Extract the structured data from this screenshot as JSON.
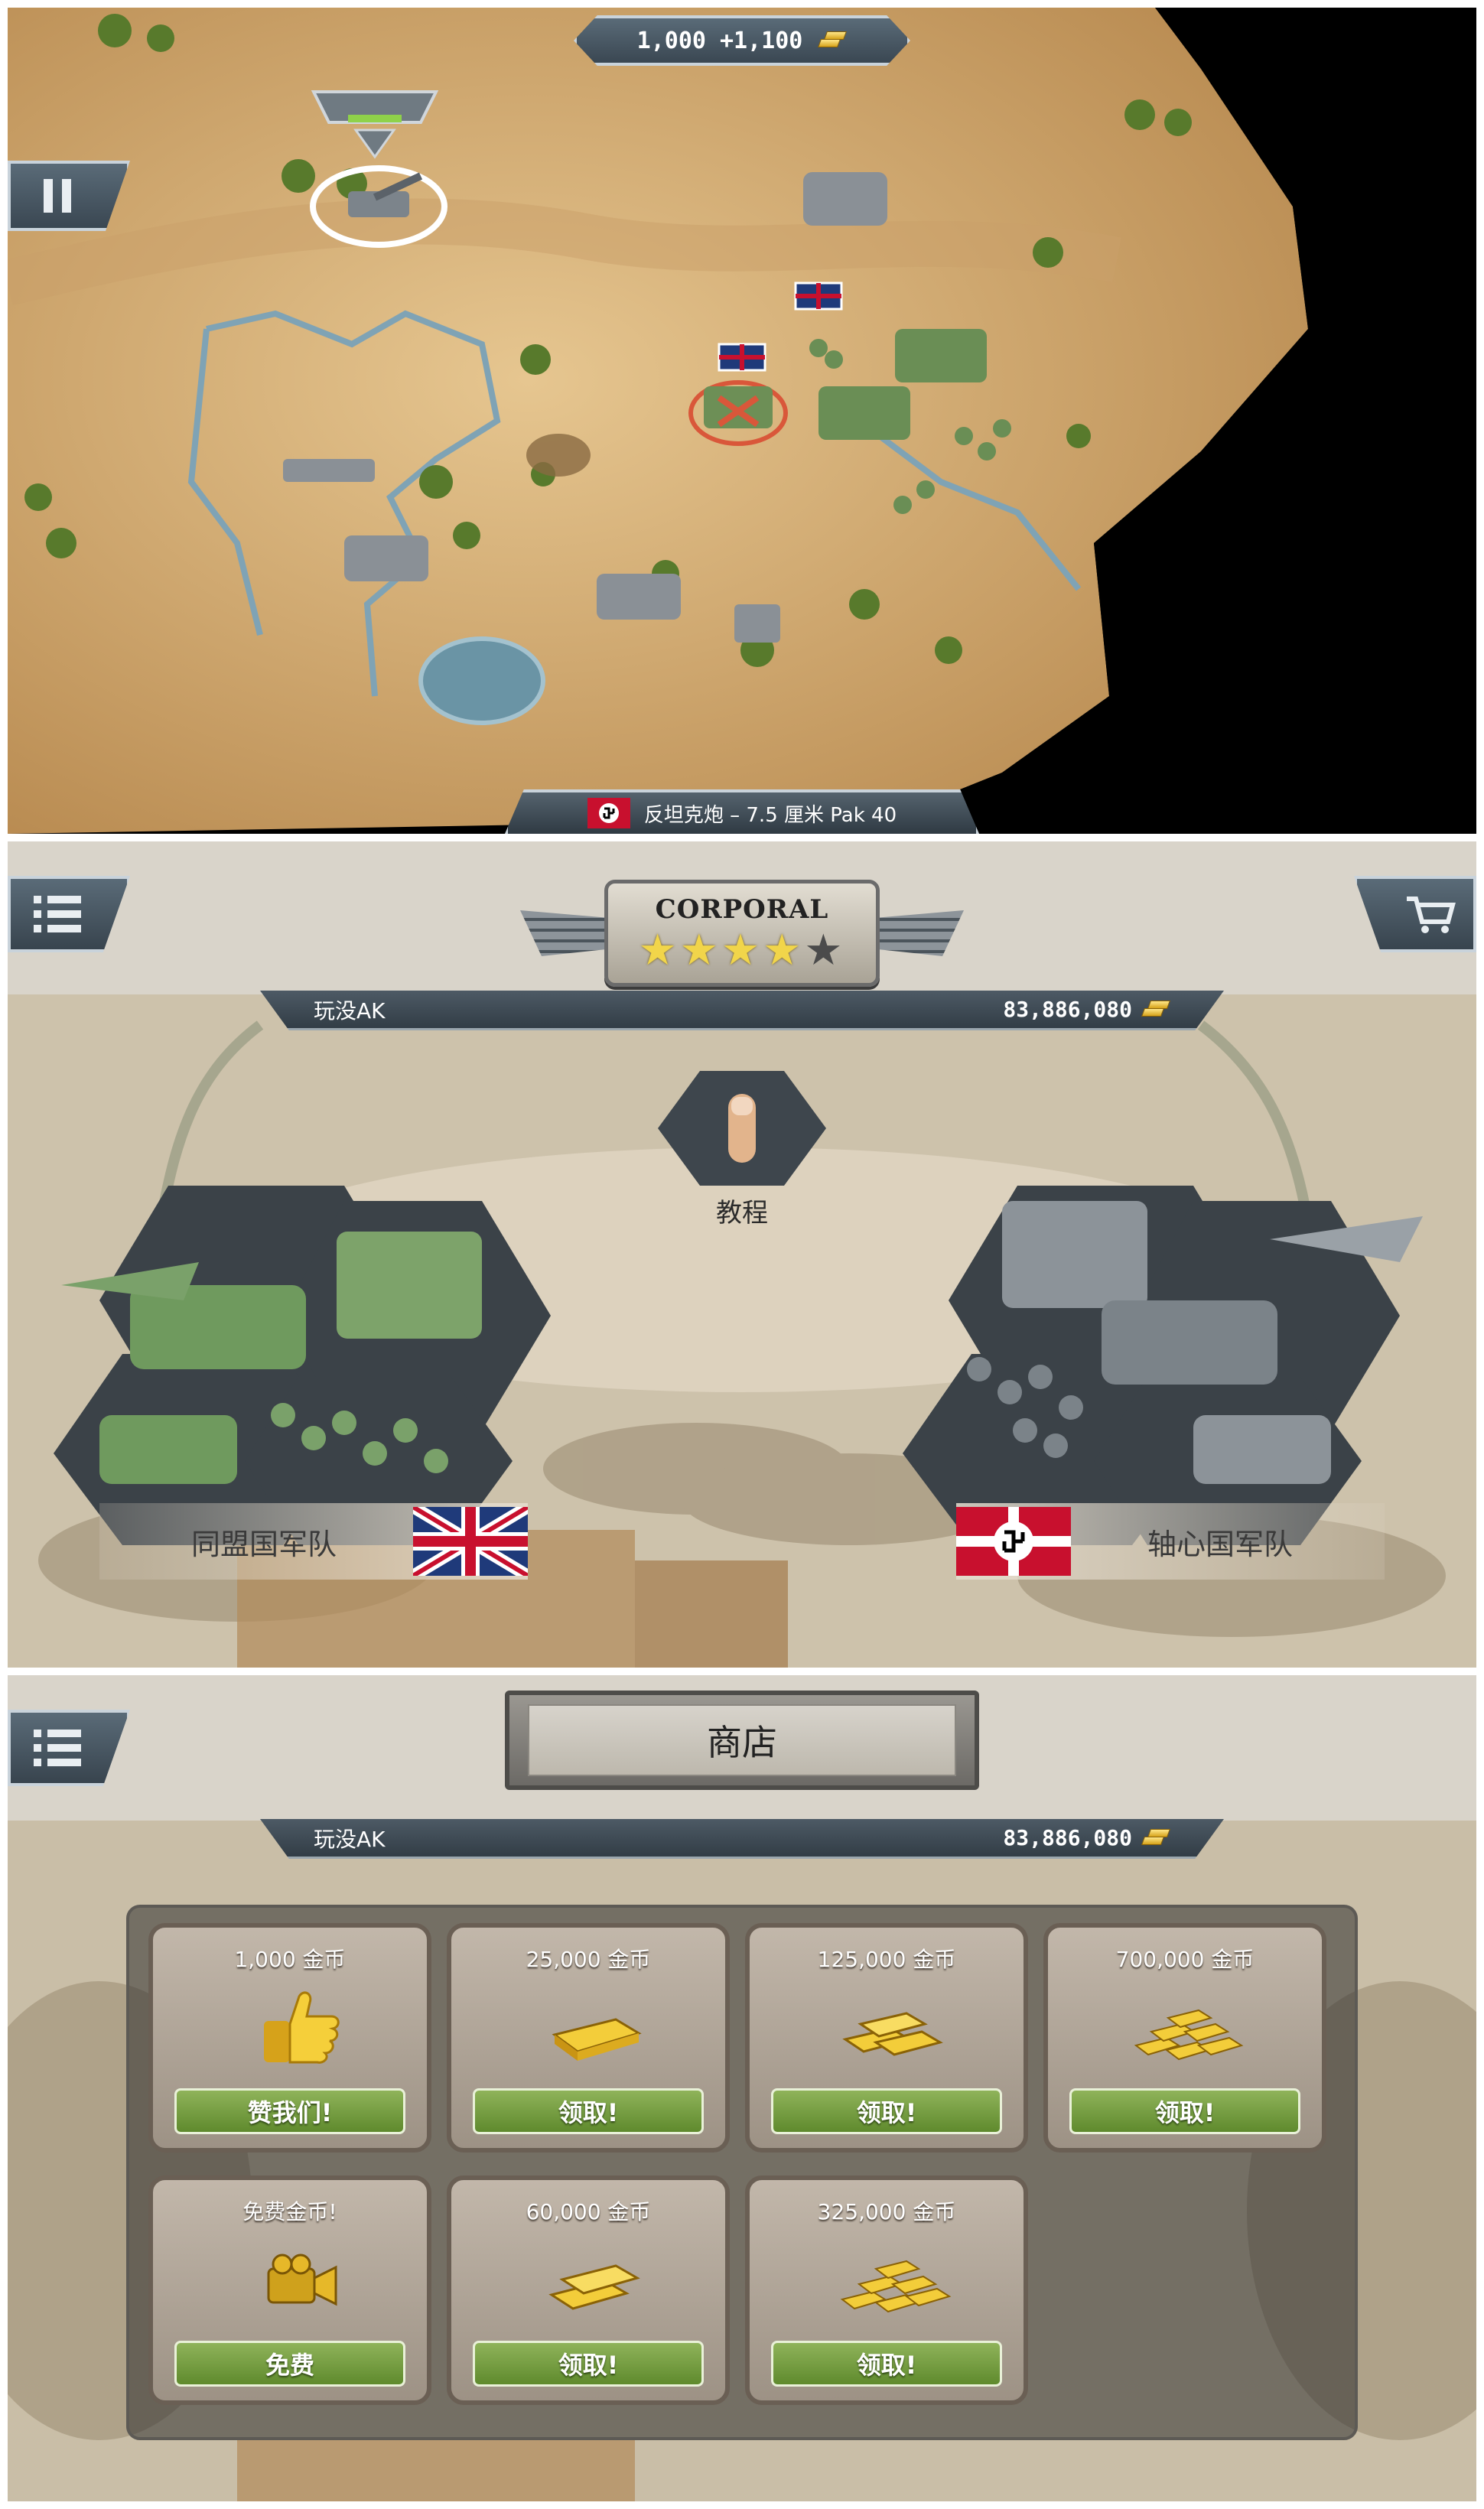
{
  "battle": {
    "gold": "1,000",
    "income": "+1,100",
    "selected_unit": "反坦克炮 – 7.5 厘米 Pak 40"
  },
  "hq": {
    "rank": "CORPORAL",
    "stars_filled": 4,
    "stars_total": 5,
    "player_name": "玩没AK",
    "gold": "83,886,080",
    "tutorial_label": "教程",
    "allied_label": "同盟国军队",
    "axis_label": "轴心国军队"
  },
  "shop": {
    "title": "商店",
    "player_name": "玩没AK",
    "gold": "83,886,080",
    "items": [
      {
        "price": "1,000 金币",
        "button": "赞我们!"
      },
      {
        "price": "25,000 金币",
        "button": "领取!"
      },
      {
        "price": "125,000 金币",
        "button": "领取!"
      },
      {
        "price": "700,000 金币",
        "button": "领取!"
      },
      {
        "price": "免费金币!",
        "button": "免费"
      },
      {
        "price": "60,000 金币",
        "button": "领取!"
      },
      {
        "price": "325,000 金币",
        "button": "领取!"
      }
    ]
  },
  "colors": {
    "sand": "#d8b47a",
    "button_green": "#6d9a3a",
    "panel_slate": "#46535d"
  }
}
